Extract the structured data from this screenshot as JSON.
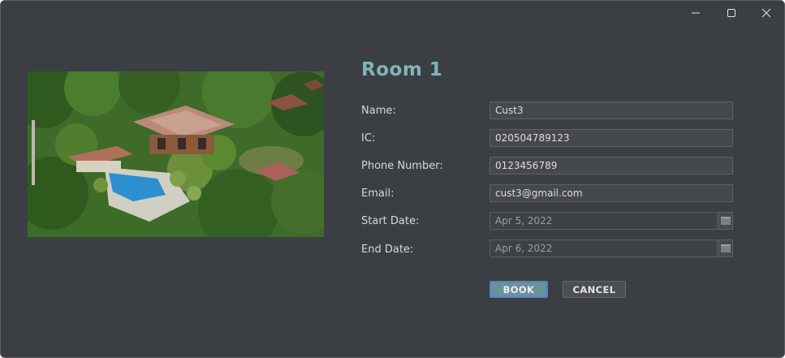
{
  "window": {
    "controls": {
      "minimize_icon": "minimize-icon",
      "maximize_icon": "maximize-icon",
      "close_icon": "close-icon"
    }
  },
  "room": {
    "title": "Room 1"
  },
  "form": {
    "name_label": "Name:",
    "name_value": "Cust3",
    "ic_label": "IC:",
    "ic_value": "020504789123",
    "phone_label": "Phone Number:",
    "phone_value": "0123456789",
    "email_label": "Email:",
    "email_value": "cust3@gmail.com",
    "start_label": "Start Date:",
    "start_value": "Apr 5, 2022",
    "end_label": "End Date:",
    "end_value": "Apr 6, 2022"
  },
  "actions": {
    "book_label": "BOOK",
    "cancel_label": "CANCEL"
  },
  "colors": {
    "window_bg": "#3b3f43",
    "title_accent": "#7fb5ba",
    "book_bg": "#6c9197",
    "focus_border": "#4d86d1"
  }
}
